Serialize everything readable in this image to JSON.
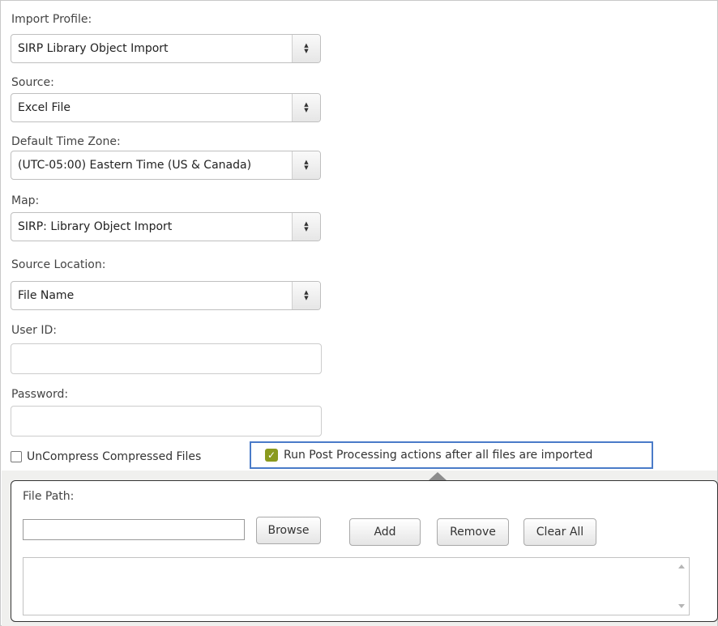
{
  "form": {
    "import_profile": {
      "label": "Import Profile:",
      "value": "SIRP Library Object Import"
    },
    "source": {
      "label": "Source:",
      "value": "Excel File"
    },
    "time_zone": {
      "label": "Default Time Zone:",
      "value": "(UTC-05:00) Eastern Time (US & Canada)"
    },
    "map": {
      "label": "Map:",
      "value": "SIRP: Library Object Import"
    },
    "source_location": {
      "label": "Source Location:",
      "value": "File Name"
    },
    "user_id": {
      "label": "User ID:",
      "value": ""
    },
    "password": {
      "label": "Password:",
      "value": ""
    },
    "uncompress": {
      "label": "UnCompress Compressed Files",
      "checked": false
    },
    "post_processing": {
      "label": "Run Post Processing actions after all files are imported",
      "checked": true
    }
  },
  "file_panel": {
    "label": "File Path:",
    "path_value": "",
    "browse": "Browse",
    "add": "Add",
    "remove": "Remove",
    "clear_all": "Clear All"
  },
  "colors": {
    "checkbox_checked": "#8a9a1e",
    "highlight_border": "#4a7bc8"
  },
  "icons": {
    "select_arrow": "up-down-arrows",
    "checkmark": "checkmark"
  }
}
